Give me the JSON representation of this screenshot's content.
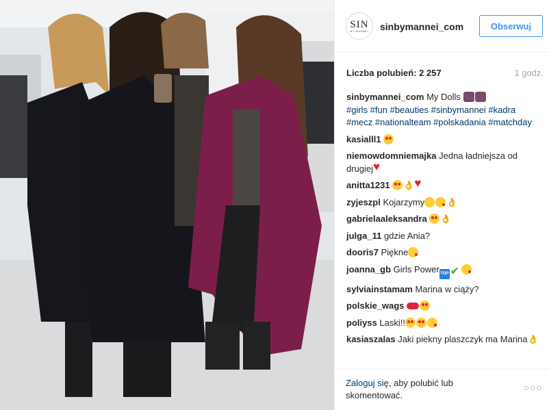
{
  "post": {
    "photo_label": "post-photo"
  },
  "header": {
    "avatar_logo": "SIN",
    "avatar_sub": "BY MANNEI",
    "username": "sinbymannei_com",
    "follow_label": "Obserwuj"
  },
  "meta": {
    "likes": "Liczba polubień: 2 257",
    "time": "1 godz."
  },
  "caption": {
    "user": "sinbymannei_com",
    "text": "My Dolls",
    "hashtags": "#girls #fun #beauties #sinbymannei #kadra #mecz #nationalteam #polskadania #matchday"
  },
  "comments": [
    {
      "user": "kasialll1",
      "text": "",
      "emojis": [
        "hearteyes"
      ]
    },
    {
      "user": "niemowdomniemajka",
      "text": "Jedna ładniejsza od drugiej",
      "emojis": [
        "heart"
      ]
    },
    {
      "user": "anitta1231",
      "text": "",
      "emojis": [
        "hearteyes",
        "ok",
        "heart"
      ]
    },
    {
      "user": "zyjeszpl",
      "text": "Kojarzymy",
      "emojis": [
        "smile",
        "wink",
        "ok"
      ]
    },
    {
      "user": "gabrielaaleksandra",
      "text": "",
      "emojis": [
        "hearteyes",
        "ok"
      ]
    },
    {
      "user": "julga_11",
      "text": "gdzie Ania?",
      "emojis": []
    },
    {
      "user": "dooris7",
      "text": "Piękne",
      "emojis": [
        "wink"
      ]
    },
    {
      "user": "joanna_gb",
      "text": "Girls Power",
      "emojis": [
        "top",
        "check",
        "wink"
      ]
    },
    {
      "user": "sylviainstamam",
      "text": "Marina w ciąży?",
      "emojis": []
    },
    {
      "user": "polskie_wags",
      "text": "",
      "emojis": [
        "lips",
        "hearteyes"
      ]
    },
    {
      "user": "poliyss",
      "text": "Laski!!",
      "emojis": [
        "hearteyes",
        "hearteyes",
        "wink"
      ]
    },
    {
      "user": "kasiaszalas",
      "text": "Jaki piekny plaszczyk ma Marina",
      "emojis": [
        "ok"
      ]
    }
  ],
  "footer": {
    "login_link": "Zaloguj się",
    "login_rest": ", aby polubić lub skomentować.",
    "more": "○○○"
  },
  "colors": {
    "link": "#003569",
    "follow": "#3897f0",
    "coat_burgundy": "#7b1f4a",
    "coat_black": "#15161c"
  }
}
